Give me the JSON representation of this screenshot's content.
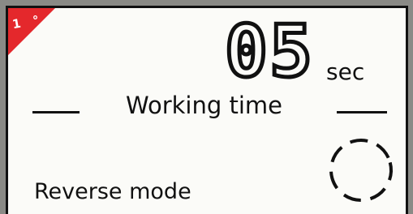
{
  "badge": {
    "label": "1 °"
  },
  "timer": {
    "value": "05",
    "unit": "sec",
    "title": "Working time"
  },
  "mode": {
    "label": "Reverse mode",
    "indicator_icon": "dashed-circle-icon"
  },
  "colors": {
    "screen": "#fbfbf8",
    "frame": "#8a8a86",
    "ink": "#111111",
    "badge": "#e4282c"
  }
}
